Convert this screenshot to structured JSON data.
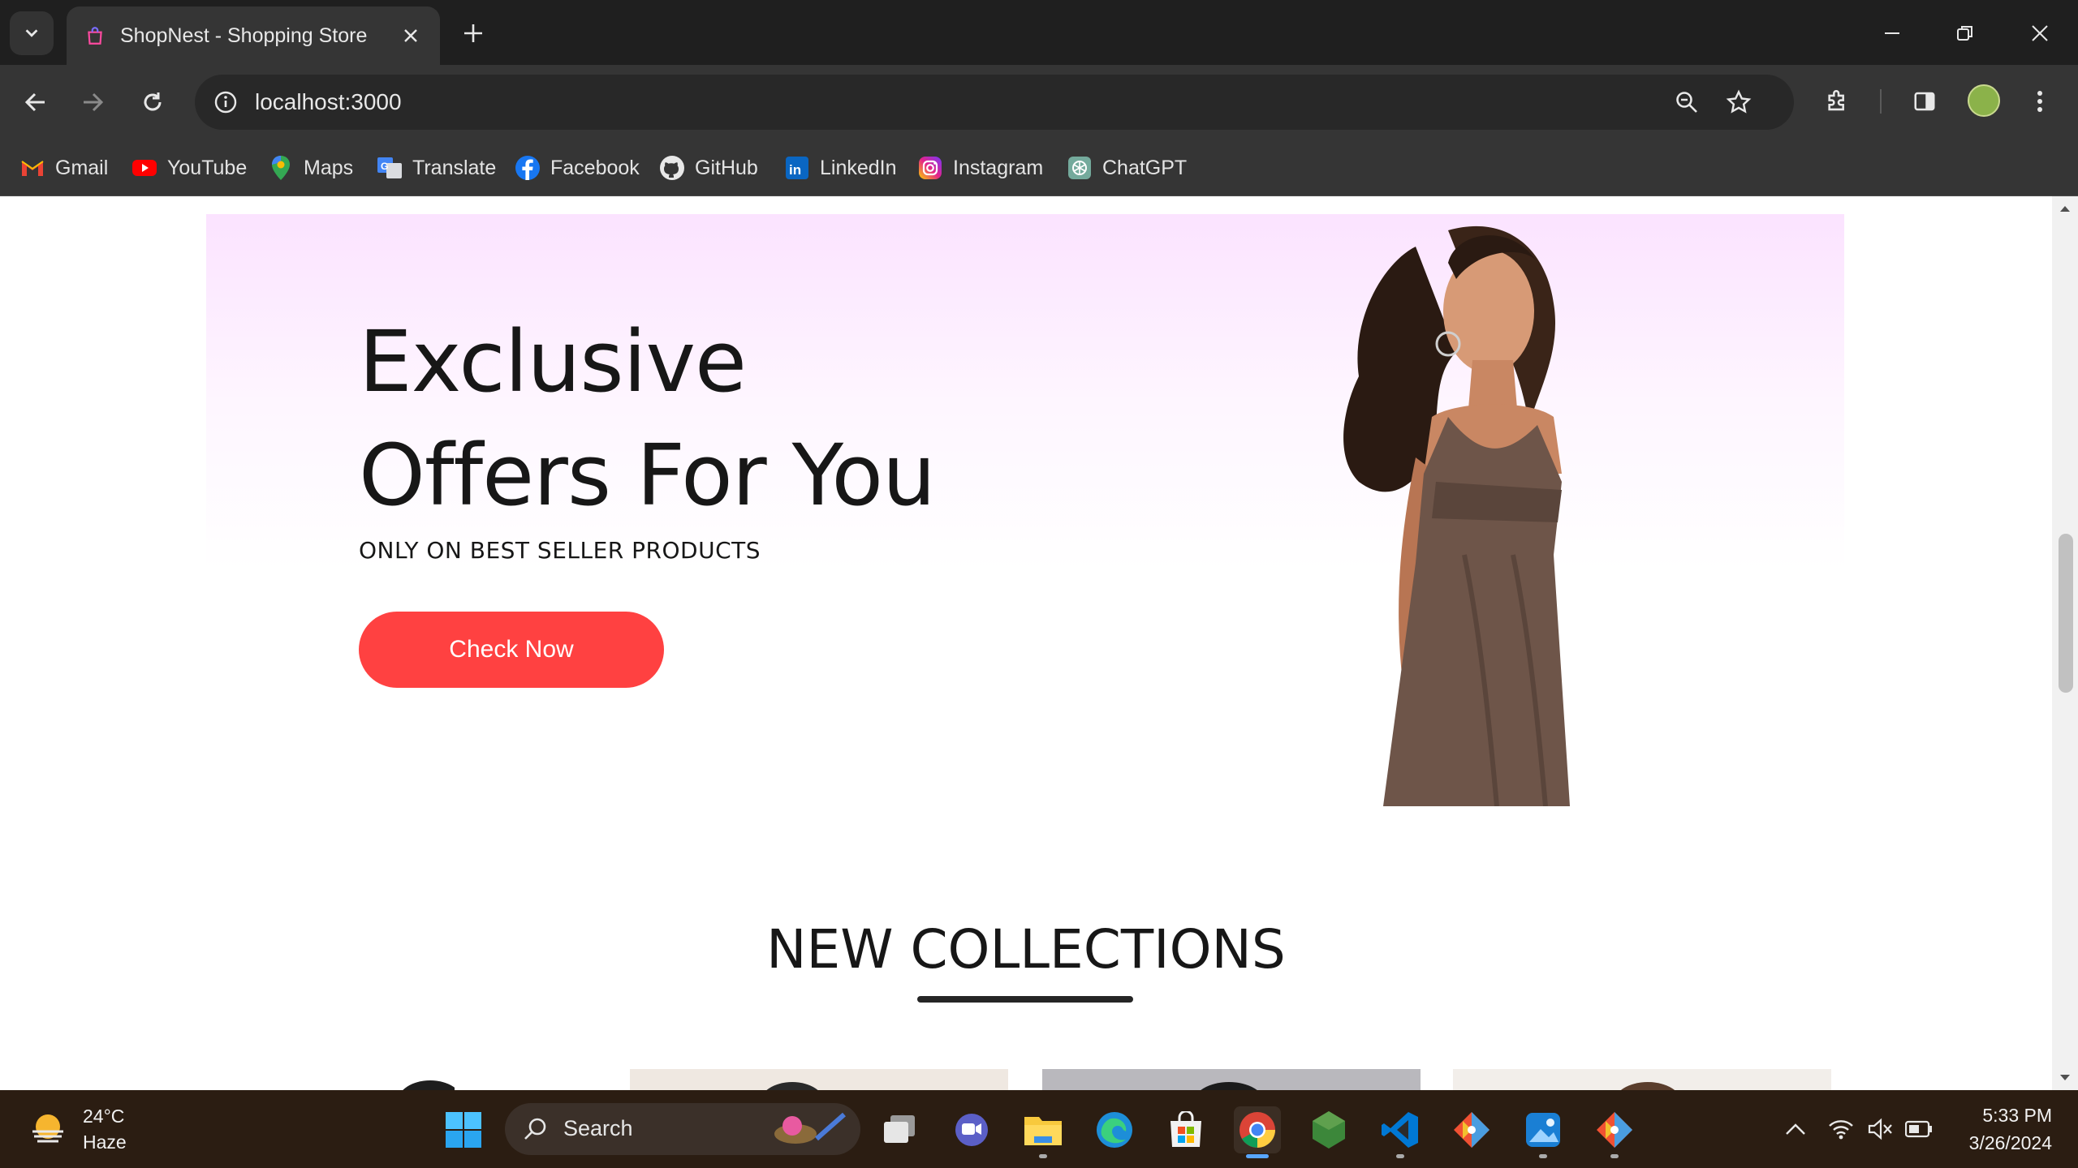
{
  "browser": {
    "tab_title": "ShopNest - Shopping Store",
    "url": "localhost:3000",
    "bookmarks": [
      {
        "label": "Gmail",
        "icon": "gmail-icon"
      },
      {
        "label": "YouTube",
        "icon": "youtube-icon"
      },
      {
        "label": "Maps",
        "icon": "maps-icon"
      },
      {
        "label": "Translate",
        "icon": "translate-icon"
      },
      {
        "label": "Facebook",
        "icon": "facebook-icon"
      },
      {
        "label": "GitHub",
        "icon": "github-icon"
      },
      {
        "label": "LinkedIn",
        "icon": "linkedin-icon"
      },
      {
        "label": "Instagram",
        "icon": "instagram-icon"
      },
      {
        "label": "ChatGPT",
        "icon": "chatgpt-icon"
      }
    ]
  },
  "hero": {
    "title_line1": "Exclusive",
    "title_line2": "Offers For You",
    "subtitle": "ONLY ON BEST SELLER PRODUCTS",
    "button_label": "Check Now"
  },
  "new_collections": {
    "title": "NEW COLLECTIONS"
  },
  "taskbar": {
    "weather_temp": "24°C",
    "weather_desc": "Haze",
    "search_label": "Search",
    "time": "5:33 PM",
    "date": "3/26/2024"
  },
  "colors": {
    "accent_button": "#ff4141",
    "hero_gradient_top": "#fbe3ff",
    "browser_chrome": "#353535",
    "taskbar": "#2b1d12"
  }
}
